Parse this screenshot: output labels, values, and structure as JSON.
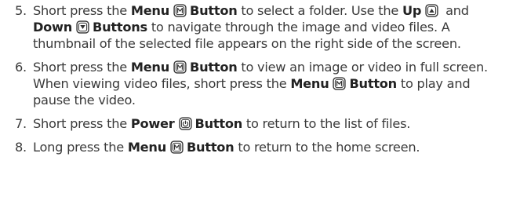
{
  "steps": [
    {
      "number": "5.",
      "text_1": "Short press the ",
      "bold_1": "Menu",
      "icon_1": "menu-m-icon",
      "bold_2": "Button",
      "text_2": " to select a folder. Use the ",
      "bold_3": "Up",
      "icon_2": "up-arrow-icon",
      "text_3": " and ",
      "bold_4": "Down",
      "icon_3": "down-arrow-icon",
      "bold_5": "Buttons",
      "text_4": " to navigate through the image and video files. A thumbnail of the selected file appears on the right side of the screen."
    },
    {
      "number": "6.",
      "text_1": "Short press the ",
      "bold_1": "Menu",
      "icon_1": "menu-m-icon",
      "bold_2": "Button",
      "text_2": " to view an image or video in full screen. When viewing video files, short press the ",
      "bold_3": "Menu",
      "icon_2": "menu-m-icon",
      "bold_4": "Button",
      "text_3": " to play and pause the video."
    },
    {
      "number": "7.",
      "text_1": "Short press the ",
      "bold_1": "Power",
      "icon_1": "power-icon",
      "bold_2": "Button",
      "text_2": " to return to the list of files."
    },
    {
      "number": "8.",
      "text_1": "Long press the ",
      "bold_1": "Menu",
      "icon_1": "menu-m-icon",
      "bold_2": "Button",
      "text_2": " to return to the home screen."
    }
  ]
}
